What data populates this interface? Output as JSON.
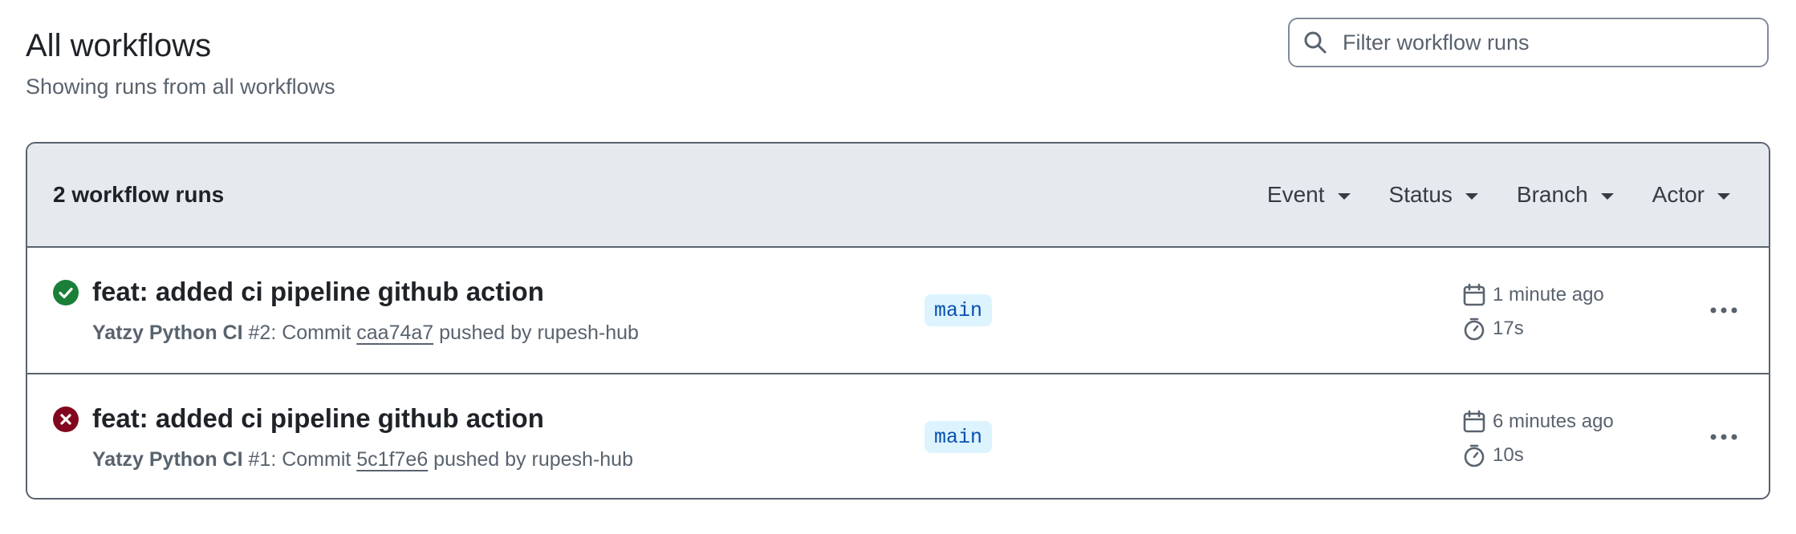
{
  "header": {
    "title": "All workflows",
    "subtitle": "Showing runs from all workflows"
  },
  "search": {
    "placeholder": "Filter workflow runs",
    "icon": "search-icon"
  },
  "runs_header": {
    "count_label": "2 workflow runs",
    "filters": [
      "Event",
      "Status",
      "Branch",
      "Actor"
    ]
  },
  "runs": [
    {
      "status": "success",
      "status_icon": "check-circle-icon",
      "status_color": "#1a7f37",
      "title": "feat: added ci pipeline github action",
      "workflow_name": "Yatzy Python CI",
      "run_number": "#2",
      "commit_prefix": ": Commit ",
      "commit_sha": "caa74a7",
      "pushed_by": " pushed by rupesh-hub",
      "branch": "main",
      "time_ago": "1 minute ago",
      "duration": "17s"
    },
    {
      "status": "failure",
      "status_icon": "x-circle-icon",
      "status_color": "#82071e",
      "title": "feat: added ci pipeline github action",
      "workflow_name": "Yatzy Python CI",
      "run_number": "#1",
      "commit_prefix": ": Commit ",
      "commit_sha": "5c1f7e6",
      "pushed_by": " pushed by rupesh-hub",
      "branch": "main",
      "time_ago": "6 minutes ago",
      "duration": "10s"
    }
  ],
  "colors": {
    "header_bg": "#e6eaef",
    "branch_bg": "#ddf4ff",
    "branch_text": "#0550ae",
    "muted_text": "#59636e"
  }
}
